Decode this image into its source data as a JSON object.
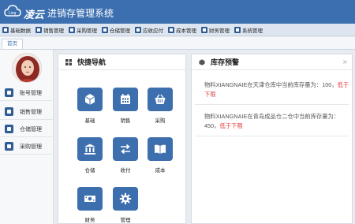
{
  "header": {
    "brand": "凌云",
    "title": "进销存管理系统"
  },
  "menu": [
    {
      "label": "基础数据",
      "icon": "database-icon"
    },
    {
      "label": "销售管理",
      "icon": "sales-icon"
    },
    {
      "label": "采购管理",
      "icon": "purchase-icon"
    },
    {
      "label": "仓储管理",
      "icon": "warehouse-icon"
    },
    {
      "label": "应收应付",
      "icon": "ledger-icon"
    },
    {
      "label": "成本管理",
      "icon": "cost-icon"
    },
    {
      "label": "财务管理",
      "icon": "finance-icon"
    },
    {
      "label": "系统管理",
      "icon": "system-icon"
    }
  ],
  "tabs": {
    "home": "首页"
  },
  "sidebar": {
    "items": [
      {
        "label": "账号管理",
        "icon": "user-icon"
      },
      {
        "label": "销售管理",
        "icon": "document-icon"
      },
      {
        "label": "仓储管理",
        "icon": "warehouse-icon"
      },
      {
        "label": "采购管理",
        "icon": "cart-icon"
      }
    ]
  },
  "quick_nav": {
    "title": "快捷导航",
    "tiles": [
      {
        "label": "基础",
        "icon": "cube-icon"
      },
      {
        "label": "销售",
        "icon": "calendar-icon"
      },
      {
        "label": "采购",
        "icon": "basket-icon"
      },
      {
        "label": "仓储",
        "icon": "bank-icon"
      },
      {
        "label": "收付",
        "icon": "exchange-icon"
      },
      {
        "label": "成本",
        "icon": "book-icon"
      },
      {
        "label": "财务",
        "icon": "money-icon"
      },
      {
        "label": "管理",
        "icon": "gear-icon"
      }
    ]
  },
  "stock_alert": {
    "title": "库存预警",
    "items": [
      {
        "text": "物料XIANGNAIE在天津仓库中当前库存量为：100，",
        "warn": "低于下限"
      },
      {
        "text": "物料XIANGNAIE在青岛成品仓二仓中当前库存量为：450，",
        "warn": "低于下限"
      }
    ]
  },
  "colors": {
    "primary": "#3b6fb0",
    "tile": "#3d6fae",
    "warning": "#e03a3a"
  }
}
